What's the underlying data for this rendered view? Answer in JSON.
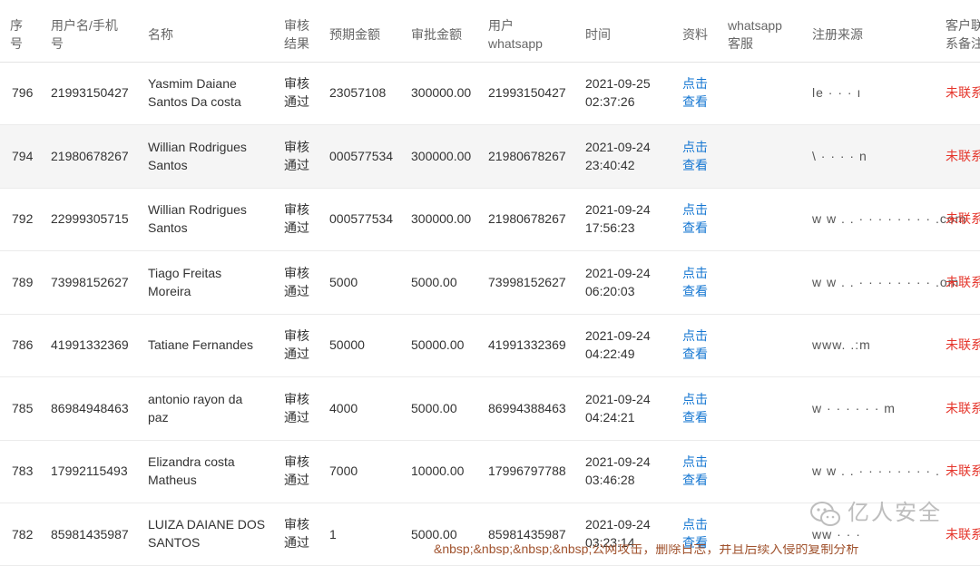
{
  "headers": {
    "seq": [
      "序",
      "号"
    ],
    "user": [
      "用户名/手机",
      "号"
    ],
    "name": [
      "名称"
    ],
    "result": [
      "审核",
      "结果"
    ],
    "expected": [
      "预期金额"
    ],
    "approved": [
      "审批金额"
    ],
    "user_whatsapp": [
      "用户",
      "whatsapp"
    ],
    "time": [
      "时间"
    ],
    "info": [
      "资料"
    ],
    "wa_service": [
      "whatsapp",
      "客服"
    ],
    "source": [
      "注册来源"
    ],
    "note": [
      "客户联",
      "系备注"
    ]
  },
  "rows": [
    {
      "seq": "796",
      "user": "21993150427",
      "name": [
        "Yasmim Daiane",
        "Santos Da costa"
      ],
      "result": [
        "审核",
        "通过"
      ],
      "expected": "23057108",
      "approved": "300000.00",
      "whatsapp": "21993150427",
      "time": [
        "2021-09-25",
        "02:37:26"
      ],
      "link": [
        "点击",
        "查看"
      ],
      "source": "le  ·   ·   ·          ı",
      "note": "未联系"
    },
    {
      "seq": "794",
      "user": "21980678267",
      "name": [
        "Willian Rodrigues",
        "Santos"
      ],
      "result": [
        "审核",
        "通过"
      ],
      "expected": "000577534",
      "approved": "300000.00",
      "whatsapp": "21980678267",
      "time": [
        "2021-09-24",
        "23:40:42"
      ],
      "link": [
        "点击",
        "查看"
      ],
      "source": "\\      ·   ·  ·  ·        n",
      "note": "未联系"
    },
    {
      "seq": "792",
      "user": "22999305715",
      "name": [
        "Willian Rodrigues",
        "Santos"
      ],
      "result": [
        "审核",
        "通过"
      ],
      "expected": "000577534",
      "approved": "300000.00",
      "whatsapp": "21980678267",
      "time": [
        "2021-09-24",
        "17:56:23"
      ],
      "link": [
        "点击",
        "查看"
      ],
      "source": "w w . . · · · · · · · · .com",
      "note": "未联系"
    },
    {
      "seq": "789",
      "user": "73998152627",
      "name": [
        "Tiago Freitas",
        "Moreira"
      ],
      "result": [
        "审核",
        "通过"
      ],
      "expected": "5000",
      "approved": "5000.00",
      "whatsapp": "73998152627",
      "time": [
        "2021-09-24",
        "06:20:03"
      ],
      "link": [
        "点击",
        "查看"
      ],
      "source": "w w . . · · · · · · · · .om",
      "note": "未联系"
    },
    {
      "seq": "786",
      "user": "41991332369",
      "name": [
        "Tatiane Fernandes"
      ],
      "result": [
        "审核",
        "通过"
      ],
      "expected": "50000",
      "approved": "50000.00",
      "whatsapp": "41991332369",
      "time": [
        "2021-09-24",
        "04:22:49"
      ],
      "link": [
        "点击",
        "查看"
      ],
      "source": "www.                .:m",
      "note": "未联系"
    },
    {
      "seq": "785",
      "user": "86984948463",
      "name": [
        "antonio rayon da",
        "paz"
      ],
      "result": [
        "审核",
        "通过"
      ],
      "expected": "4000",
      "approved": "5000.00",
      "whatsapp": "86994388463",
      "time": [
        "2021-09-24",
        "04:24:21"
      ],
      "link": [
        "点击",
        "查看"
      ],
      "source": "w · · · · · ·            m",
      "note": "未联系"
    },
    {
      "seq": "783",
      "user": "17992115493",
      "name": [
        "Elizandra costa",
        "Matheus"
      ],
      "result": [
        "审核",
        "通过"
      ],
      "expected": "7000",
      "approved": "10000.00",
      "whatsapp": "17996797788",
      "time": [
        "2021-09-24",
        "03:46:28"
      ],
      "link": [
        "点击",
        "查看"
      ],
      "source": "w w . . · · · · · · · · .",
      "note": "未联系"
    },
    {
      "seq": "782",
      "user": "85981435987",
      "name": [
        "LUIZA DAIANE DOS",
        "SANTOS"
      ],
      "result": [
        "审核",
        "通过"
      ],
      "expected": "1",
      "approved": "5000.00",
      "whatsapp": "85981435987",
      "time": [
        "2021-09-24",
        "03:23:14"
      ],
      "link": [
        "点击",
        "查看"
      ],
      "source": "ww  ·   ·   ·",
      "note": "未联系"
    }
  ],
  "watermark": {
    "text": "亿人安全",
    "icon": "wechat-icon"
  },
  "bottom_overlay": "&nbsp;&nbsp;&nbsp;&nbsp;公网攻击，删除日志，并且后续入侵的复制分析",
  "colors": {
    "accent_blue": "#1677d2",
    "status_red": "#e5352b",
    "stripe": "#f5f5f5",
    "border": "#ebebeb"
  }
}
